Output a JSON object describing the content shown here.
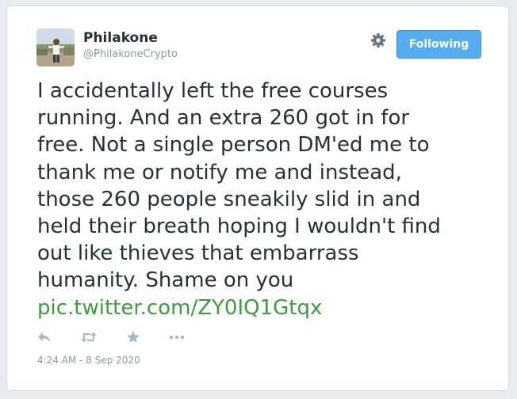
{
  "user": {
    "name": "Philakone",
    "handle": "@PhilakoneCrypto"
  },
  "follow_button": {
    "label": "Following"
  },
  "tweet": {
    "lines": [
      "I accidentally left the free courses",
      "running. And an extra 260 got in for",
      "free. Not a single person DM'ed me to",
      "thank me or notify me and instead,",
      "those 260 people sneakily slid in and",
      "held their breath hoping I wouldn't find",
      "out like thieves that embarrass",
      "humanity. Shame on you"
    ],
    "link": "pic.twitter.com/ZY0IQ1Gtqx",
    "timestamp": "4:24 AM - 8 Sep 2020"
  },
  "icons": {
    "settings": "gear-icon",
    "reply": "reply-icon",
    "retweet": "retweet-icon",
    "favorite": "star-icon",
    "more": "more-icon"
  },
  "colors": {
    "follow_button_bg": "#55acee",
    "link": "#3e9b3e",
    "text": "#292f33",
    "muted": "#8899a6",
    "action_icons": "#aab8c2"
  }
}
